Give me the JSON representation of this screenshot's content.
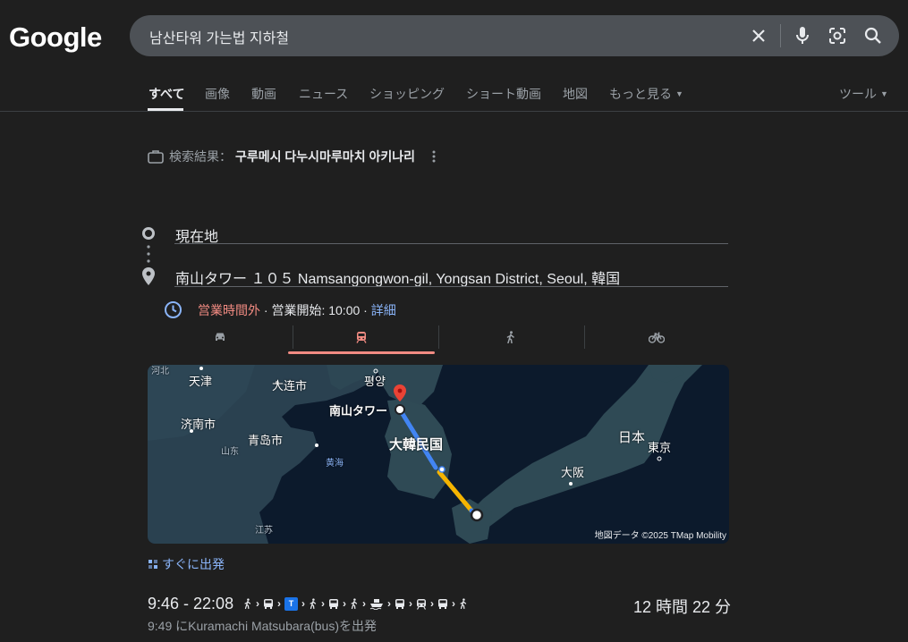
{
  "logo": "Google",
  "search": {
    "query": "남산타워 가는법 지하철"
  },
  "tabs": [
    {
      "label": "すべて"
    },
    {
      "label": "画像"
    },
    {
      "label": "動画"
    },
    {
      "label": "ニュース"
    },
    {
      "label": "ショッピング"
    },
    {
      "label": "ショート動画"
    },
    {
      "label": "地図"
    },
    {
      "label": "もっと見る"
    }
  ],
  "tools": "ツール",
  "result": {
    "prefix": "検索結果：",
    "name": "구루메시 다누시마루마치 아키나리"
  },
  "route": {
    "origin": "現在地",
    "destination": "南山タワー １０５ Namsangongwon-gil, Yongsan District, Seoul, 韓国"
  },
  "hours": {
    "status": "営業時間外",
    "sep1": " · ",
    "open": "営業開始: 10:00",
    "sep2": " · ",
    "details": "詳細"
  },
  "modes": [
    {
      "icon": "car-icon"
    },
    {
      "icon": "train-icon",
      "active": true
    },
    {
      "icon": "walk-icon"
    },
    {
      "icon": "bicycle-icon"
    }
  ],
  "map": {
    "labels": {
      "hebei": "河北",
      "tianjin": "天津",
      "dalian": "大连市",
      "pyongyang": "평양",
      "namsan": "南山タワー",
      "jinan": "济南市",
      "shandong": "山东",
      "qingdao": "青岛市",
      "korea": "大韓民国",
      "yellowsea": "黄海",
      "jiangsu": "江苏",
      "japan": "日本",
      "tokyo": "東京",
      "osaka": "大阪"
    },
    "attribution": "地図データ ©2025 TMap Mobility",
    "colors": {
      "route_blue": "#4285f4",
      "route_yellow": "#f5b400",
      "pin": "#ea4335"
    }
  },
  "leave_now": "すぐに出発",
  "trip": {
    "time": "9:46 - 22:08",
    "duration": "12 時間 22 分",
    "depart": "9:49 にKuramachi Matsubara(bus)を出発",
    "steps": [
      "walk-icon",
      "bus-icon",
      "train-badge-icon",
      "walk-icon",
      "bus-icon",
      "walk-icon",
      "ferry-icon",
      "bus-icon",
      "train-icon",
      "bus-icon",
      "walk-icon"
    ],
    "train_badge": "T"
  }
}
